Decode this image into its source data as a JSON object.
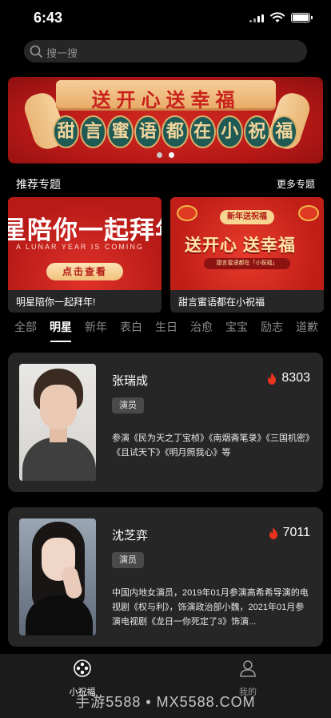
{
  "status_bar": {
    "time": "6:43"
  },
  "search": {
    "placeholder": "搜一搜"
  },
  "banner": {
    "top_text": "送开心送幸福",
    "seal_chars": [
      "甜",
      "言",
      "蜜",
      "语",
      "都",
      "在",
      "小",
      "祝",
      "福"
    ],
    "page_count": 2,
    "active_page": 2
  },
  "section": {
    "title": "推荐专题",
    "more": "更多专题"
  },
  "topics": [
    {
      "caption": "明星陪你一起拜年!",
      "image_title": "星陪你一起拜年",
      "image_subtitle": "A LUNAR YEAR IS COMING",
      "image_button": "点击查看"
    },
    {
      "caption": "甜言蜜语都在小祝福",
      "image_badge": "新年送祝福",
      "image_title": "送开心 送幸福",
      "image_subtitle": "甜言蜜语都在「小祝福」"
    }
  ],
  "tabs": [
    "全部",
    "明星",
    "新年",
    "表白",
    "生日",
    "治愈",
    "宝宝",
    "励志",
    "道歉"
  ],
  "active_tab": "明星",
  "celebs": [
    {
      "name": "张瑞成",
      "heat": "8303",
      "tag": "演员",
      "desc": "参演《民为天之丁宝桢》《南烟斋笔录》《三国机密》《且试天下》《明月照我心》等"
    },
    {
      "name": "沈芝弈",
      "heat": "7011",
      "tag": "演员",
      "desc": "中国内地女演员，2019年01月参演高希希导演的电视剧《权与利》，饰演政治部小魏，2021年01月参演电视剧《龙日一你死定了3》饰演..."
    }
  ],
  "bottom_nav": [
    {
      "label": "小祝福",
      "icon": "film-reel-icon",
      "active": true
    },
    {
      "label": "我的",
      "icon": "user-icon",
      "active": false
    }
  ],
  "watermark": "手游5588 • MX5588.COM",
  "colors": {
    "background": "#000000",
    "card": "#262626",
    "heat_flame": "#e8331f",
    "nav": "#1b1b1b"
  }
}
